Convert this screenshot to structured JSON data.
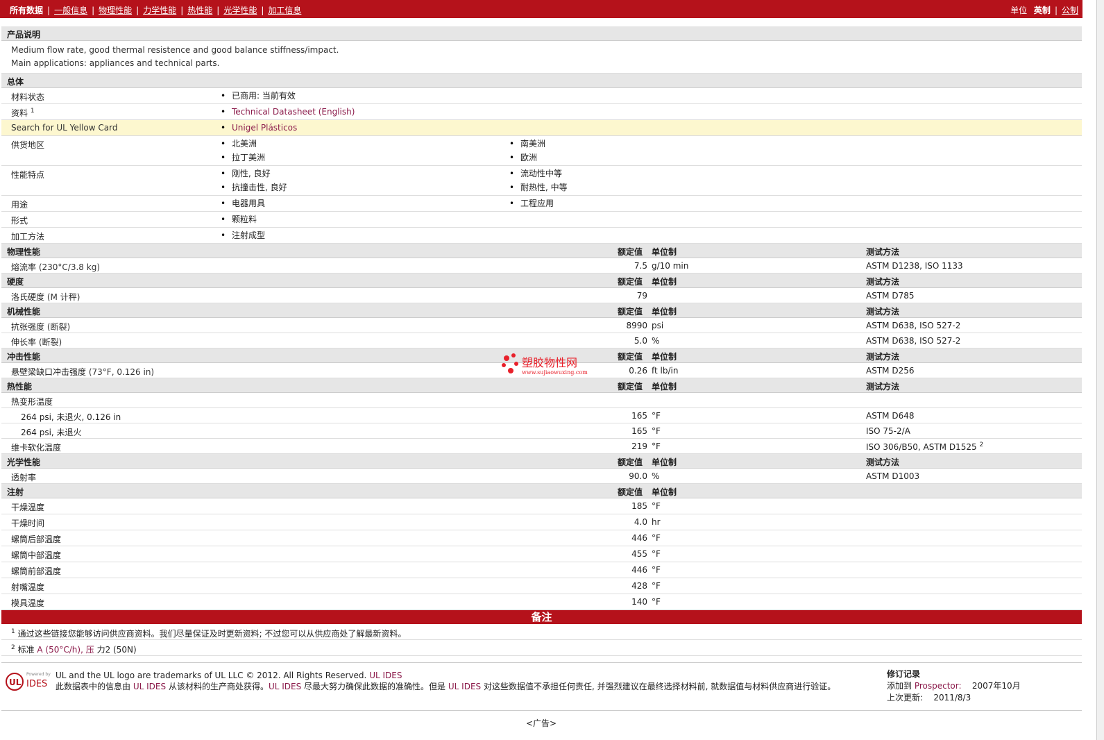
{
  "nav": {
    "items": [
      "所有数据",
      "一般信息",
      "物理性能",
      "力学性能",
      "热性能",
      "光学性能",
      "加工信息"
    ],
    "units_label": "单位",
    "unit_english": "英制",
    "unit_metric": "公制"
  },
  "headers": {
    "nominal": "额定值",
    "unit": "单位制",
    "method": "测试方法"
  },
  "product": {
    "title": "产品说明",
    "lines": [
      "Medium flow rate, good thermal resistence and good balance stiffness/impact.",
      "Main applications: appliances and technical parts."
    ]
  },
  "general": {
    "title": "总体",
    "status_label": "材料状态",
    "status_value": "已商用: 当前有效",
    "doc_label": "资料",
    "doc_sup": "1",
    "doc_value": "Technical Datasheet (English)",
    "ul_label": "Search for UL Yellow Card",
    "ul_value": "Unigel Plásticos",
    "region_label": "供货地区",
    "regions": [
      "北美洲",
      "南美洲",
      "拉丁美洲",
      "欧洲"
    ],
    "feature_label": "性能特点",
    "features": [
      "刚性, 良好",
      "流动性中等",
      "抗撞击性, 良好",
      "耐热性, 中等"
    ],
    "use_label": "用途",
    "uses": [
      "电器用具",
      "工程应用"
    ],
    "form_label": "形式",
    "form": "颗粒料",
    "process_label": "加工方法",
    "process": "注射成型"
  },
  "physical": {
    "title": "物理性能",
    "rows": [
      {
        "label": "熔流率",
        "cond": "(230°C/3.8 kg)",
        "value": "7.5",
        "unit": "g/10 min",
        "method": "ASTM D1238, ISO 1133"
      }
    ]
  },
  "hardness": {
    "title": "硬度",
    "rows": [
      {
        "label": "洛氏硬度",
        "cond": "(M 计秤)",
        "value": "79",
        "unit": "",
        "method": "ASTM D785"
      }
    ]
  },
  "mechanical": {
    "title": "机械性能",
    "rows": [
      {
        "label": "抗张强度",
        "cond": "(断裂)",
        "value": "8990",
        "unit": "psi",
        "method": "ASTM D638, ISO 527-2"
      },
      {
        "label": "伸长率",
        "cond": "(断裂)",
        "value": "5.0",
        "unit": "%",
        "method": "ASTM D638, ISO 527-2"
      }
    ]
  },
  "impact": {
    "title": "冲击性能",
    "rows": [
      {
        "label": "悬壁梁缺口冲击强度",
        "cond": "(73°F, 0.126 in)",
        "value": "0.26",
        "unit": "ft lb/in",
        "method": "ASTM D256"
      }
    ]
  },
  "thermal": {
    "title": "热性能",
    "hdt_label": "热变形温度",
    "hdt_rows": [
      {
        "label": "264 psi, 未退火, 0.126 in",
        "value": "165",
        "unit": "°F",
        "method": "ASTM D648"
      },
      {
        "label": "264 psi, 未退火",
        "value": "165",
        "unit": "°F",
        "method": "ISO 75-2/A"
      }
    ],
    "vicat": {
      "label": "维卡软化温度",
      "value": "219",
      "unit": "°F",
      "method": "ISO 306/B50, ASTM D1525",
      "sup": "2"
    }
  },
  "optical": {
    "title": "光学性能",
    "rows": [
      {
        "label": "透射率",
        "value": "90.0",
        "unit": "%",
        "method": "ASTM D1003"
      }
    ]
  },
  "injection": {
    "title": "注射",
    "rows": [
      {
        "label": "干燥温度",
        "value": "185",
        "unit": "°F"
      },
      {
        "label": "干燥时间",
        "value": "4.0",
        "unit": "hr"
      },
      {
        "label": "螺筒后部温度",
        "value": "446",
        "unit": "°F"
      },
      {
        "label": "螺筒中部温度",
        "value": "455",
        "unit": "°F"
      },
      {
        "label": "螺筒前部温度",
        "value": "446",
        "unit": "°F"
      },
      {
        "label": "射嘴温度",
        "value": "428",
        "unit": "°F"
      },
      {
        "label": "模具温度",
        "value": "140",
        "unit": "°F"
      }
    ]
  },
  "notes": {
    "title": "备注",
    "n1_sup": "1",
    "n1": "通过这些链接您能够访问供应商资料。我们尽量保证及时更新资料; 不过您可以从供应商处了解最新资料。",
    "n2_sup": "2",
    "n2_a": "标准",
    "n2_b": "A (50°C/h), 压",
    "n2_c": "力2 (50N)"
  },
  "footer": {
    "powered": "Powered by",
    "ides": "IDES",
    "ul": "UL",
    "line1": "UL and the UL logo are trademarks of UL LLC © 2012. All Rights Reserved.",
    "line1_link": "UL IDES",
    "line2a": "此数据表中的信息由",
    "line2_link1": "UL IDES",
    "line2b": "从该材料的生产商处获得。",
    "line2_link2": "UL IDES",
    "line2c": "尽最大努力确保此数据的准确性。但是",
    "line2_link3": "UL IDES",
    "line2d": "对这些数据值不承担任何责任, 并强烈建议在最终选择材料前, 就数据值与材料供应商进行验证。",
    "rev_title": "修订记录",
    "added_label": "添加到",
    "added_link": "Prospector:",
    "added_date": "2007年10月",
    "updated_label": "上次更新:",
    "updated_date": "2011/8/3"
  },
  "ad": "<广告>",
  "watermark": {
    "title": "塑胶物性网",
    "url": "www.sujiaowuxing.com"
  },
  "colors": {
    "brand": "#b5121b",
    "highlight": "#fdf7cf",
    "link": "#8b1a4a"
  }
}
